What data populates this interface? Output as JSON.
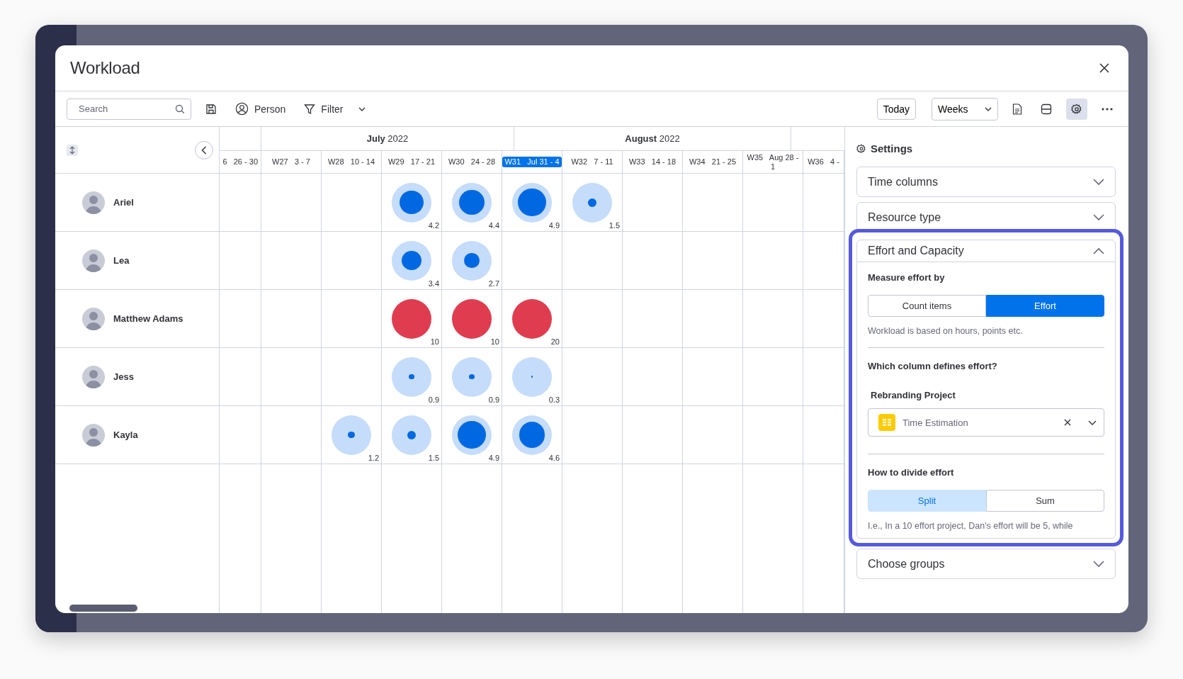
{
  "window": {
    "title": "Workload"
  },
  "toolbar": {
    "search": {
      "placeholder": "Search"
    },
    "person": "Person",
    "filter": "Filter",
    "today": "Today",
    "view": "Weeks",
    "settings_selected": true
  },
  "timeline": {
    "months": [
      {
        "name": "July",
        "year": "2022"
      },
      {
        "name": "August",
        "year": "2022"
      }
    ],
    "weeks": [
      {
        "week": "6",
        "dates": "26 - 30",
        "selected": false
      },
      {
        "week": "W27",
        "dates": "3 - 7",
        "selected": false
      },
      {
        "week": "W28",
        "dates": "10 - 14",
        "selected": false
      },
      {
        "week": "W29",
        "dates": "17 - 21",
        "selected": false
      },
      {
        "week": "W30",
        "dates": "24 - 28",
        "selected": false
      },
      {
        "week": "W31",
        "dates": "Jul 31 - 4",
        "selected": true
      },
      {
        "week": "W32",
        "dates": "7 - 11",
        "selected": false
      },
      {
        "week": "W33",
        "dates": "14 - 18",
        "selected": false
      },
      {
        "week": "W34",
        "dates": "21 - 25",
        "selected": false
      },
      {
        "week": "W35",
        "dates": "Aug 28 - 1",
        "selected": false
      },
      {
        "week": "W36",
        "dates": "4 -",
        "selected": false
      }
    ],
    "people": [
      {
        "name": "Ariel",
        "cells": [
          null,
          null,
          null,
          {
            "value": "4.2",
            "overloaded": false
          },
          {
            "value": "4.4",
            "overloaded": false
          },
          {
            "value": "4.9",
            "overloaded": false
          },
          {
            "value": "1.5",
            "overloaded": false
          },
          null,
          null,
          null,
          null
        ]
      },
      {
        "name": "Lea",
        "cells": [
          null,
          null,
          null,
          {
            "value": "3.4",
            "overloaded": false
          },
          {
            "value": "2.7",
            "overloaded": false
          },
          null,
          null,
          null,
          null,
          null,
          null
        ]
      },
      {
        "name": "Matthew Adams",
        "cells": [
          null,
          null,
          null,
          {
            "value": "10",
            "overloaded": true
          },
          {
            "value": "10",
            "overloaded": true
          },
          {
            "value": "20",
            "overloaded": true
          },
          null,
          null,
          null,
          null,
          null
        ]
      },
      {
        "name": "Jess",
        "cells": [
          null,
          null,
          null,
          {
            "value": "0.9",
            "overloaded": false
          },
          {
            "value": "0.9",
            "overloaded": false
          },
          {
            "value": "0.3",
            "overloaded": false
          },
          null,
          null,
          null,
          null,
          null
        ]
      },
      {
        "name": "Kayla",
        "cells": [
          null,
          null,
          {
            "value": "1.2",
            "overloaded": false
          },
          {
            "value": "1.5",
            "overloaded": false
          },
          {
            "value": "4.9",
            "overloaded": false
          },
          {
            "value": "4.6",
            "overloaded": false
          },
          null,
          null,
          null,
          null,
          null
        ]
      }
    ]
  },
  "settings": {
    "title": "Settings",
    "sections": [
      {
        "title": "Time columns",
        "expanded": false
      },
      {
        "title": "Resource type",
        "expanded": false
      },
      {
        "title": "Effort and Capacity",
        "expanded": true,
        "highlighted": true,
        "content": {
          "measure_label": "Measure effort by",
          "measure_options": [
            {
              "label": "Count items",
              "selected": false
            },
            {
              "label": "Effort",
              "selected": true
            }
          ],
          "measure_hint": "Workload is based on hours, points etc.",
          "column_question": "Which column defines effort?",
          "board_name": "Rebranding Project",
          "column_value": "Time Estimation",
          "divide_label": "How to divide effort",
          "divide_options": [
            {
              "label": "Split",
              "selected": true
            },
            {
              "label": "Sum",
              "selected": false
            }
          ],
          "divide_hint": "I.e., In a 10 effort project, Dan's effort will be 5, while"
        }
      },
      {
        "title": "Choose groups",
        "expanded": false
      }
    ]
  }
}
